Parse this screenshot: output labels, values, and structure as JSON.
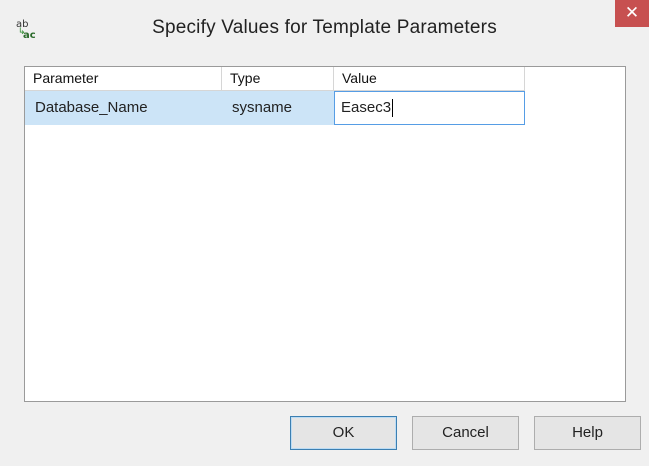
{
  "window": {
    "title": "Specify Values for Template Parameters",
    "close_glyph": "✕",
    "icon": {
      "name": "template-parameters-icon",
      "top_text": "ab",
      "arrow": "↳",
      "bottom_text": "ac"
    }
  },
  "grid": {
    "columns": [
      "Parameter",
      "Type",
      "Value"
    ],
    "rows": [
      {
        "parameter": "Database_Name",
        "type": "sysname",
        "value": "Easec3"
      }
    ]
  },
  "buttons": {
    "ok": "OK",
    "cancel": "Cancel",
    "help": "Help"
  },
  "colors": {
    "selection": "#cce4f7",
    "focus_border": "#569de5",
    "close_button": "#c75050"
  }
}
